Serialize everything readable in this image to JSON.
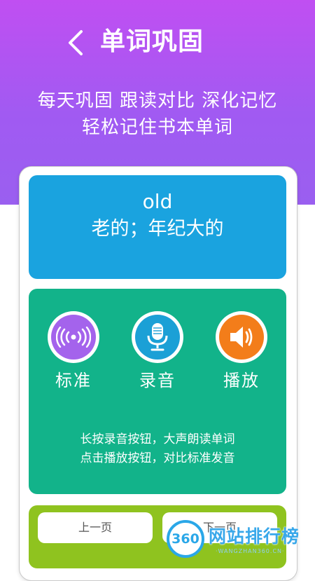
{
  "header": {
    "title": "单词巩固"
  },
  "banner": {
    "line1": "每天巩固 跟读对比 深化记忆",
    "line2": "轻松记住书本单词"
  },
  "word": {
    "english": "old",
    "chinese": "老的；年纪大的"
  },
  "controls": {
    "standard_label": "标准",
    "record_label": "录音",
    "play_label": "播放"
  },
  "instructions": {
    "line1": "长按录音按钮，大声朗读单词",
    "line2": "点击播放按钮，对比标准发音"
  },
  "nav": {
    "prev_label": "上一页",
    "next_label": "下一页"
  },
  "watermark": {
    "logo_text": "360",
    "text": "网站排行榜",
    "subtext": "·WANGZHAN360.CN·"
  },
  "colors": {
    "hero_purple": "#a15af2",
    "word_panel_blue": "#1aa3df",
    "practice_panel_green": "#12b38a",
    "nav_panel_green": "#8fc31f",
    "standard_purple": "#a463ec",
    "record_teal": "#1ba0d6",
    "play_orange": "#f37d1a"
  },
  "icons": {
    "back": "chevron-left-icon",
    "standard": "broadcast-icon",
    "record": "microphone-icon",
    "play": "speaker-icon"
  }
}
